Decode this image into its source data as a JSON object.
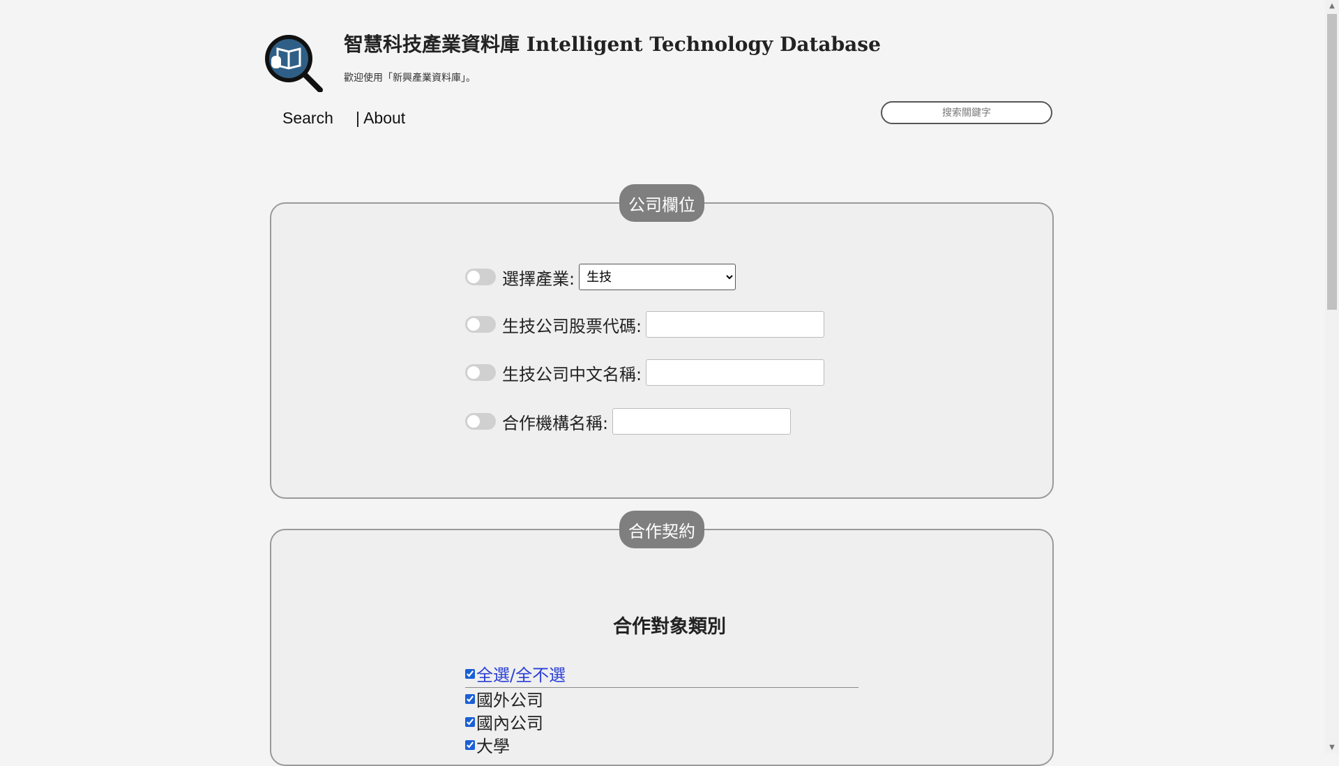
{
  "header": {
    "title": "智慧科技產業資料庫 Intelligent Technology Database",
    "subtitle": "歡迎使用「新興產業資料庫」。"
  },
  "nav": {
    "search_label": "Search",
    "about_label": "| About"
  },
  "search": {
    "placeholder": "搜索關鍵字"
  },
  "company_panel": {
    "title": "公司欄位",
    "industry_label": "選擇產業:",
    "industry_selected": "生技",
    "stock_code_label": "生技公司股票代碼:",
    "stock_code_value": "",
    "chinese_name_label": "生技公司中文名稱:",
    "chinese_name_value": "",
    "partner_name_label": "合作機構名稱:",
    "partner_name_value": ""
  },
  "coop_panel": {
    "title": "合作契約",
    "heading": "合作對象類別",
    "select_all_label": "全選/全不選",
    "options": [
      "國外公司",
      "國內公司",
      "大學"
    ]
  },
  "colors": {
    "badge": "#7f7f7f",
    "link": "#2a3fd6",
    "logo": "#2f5f86"
  }
}
